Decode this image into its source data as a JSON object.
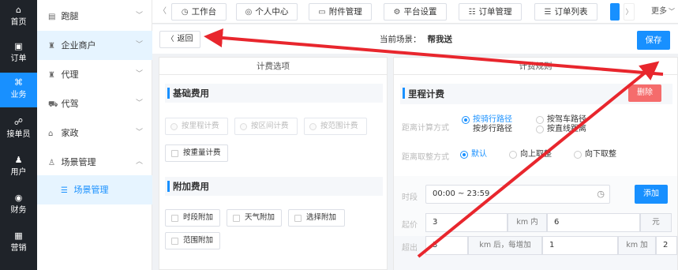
{
  "rail": [
    {
      "icon": "⌂",
      "label": "首页"
    },
    {
      "icon": "▣",
      "label": "订单"
    },
    {
      "icon": "⌘",
      "label": "业务"
    },
    {
      "icon": "☍",
      "label": "接单员"
    },
    {
      "icon": "♟",
      "label": "用户"
    },
    {
      "icon": "◉",
      "label": "财务"
    },
    {
      "icon": "▦",
      "label": "营销"
    }
  ],
  "sidebar": {
    "items": [
      {
        "icon": "▤",
        "label": "跑腿"
      },
      {
        "icon": "♜",
        "label": "企业商户"
      },
      {
        "icon": "♜",
        "label": "代理"
      },
      {
        "icon": "⛟",
        "label": "代驾"
      },
      {
        "icon": "⌂",
        "label": "家政"
      },
      {
        "icon": "♙",
        "label": "场景管理"
      },
      {
        "icon": "☰",
        "label": "场景管理"
      }
    ]
  },
  "tabs": [
    {
      "icon": "◷",
      "label": "工作台"
    },
    {
      "icon": "◎",
      "label": "个人中心"
    },
    {
      "icon": "▭",
      "label": "附件管理"
    },
    {
      "icon": "⚙",
      "label": "平台设置"
    },
    {
      "icon": "☷",
      "label": "订单管理"
    },
    {
      "icon": "☰",
      "label": "订单列表"
    }
  ],
  "more_label": "更多",
  "header": {
    "back_label": "返回",
    "scene_label": "当前场景：",
    "scene_name": "帮我送",
    "save_label": "保存"
  },
  "left_panel": {
    "title": "计费选项",
    "basic_title": "基础费用",
    "basic_options": [
      "按里程计费",
      "按区间计费",
      "按范围计费"
    ],
    "weight_option": "按重量计费",
    "extra_title": "附加费用",
    "extra_options": [
      "时段附加",
      "天气附加",
      "选择附加",
      "范围附加"
    ]
  },
  "right_panel": {
    "title": "计费规则",
    "section_title": "里程计费",
    "delete_label": "删除",
    "distance_calc_label": "距离计算方式",
    "distance_calc_options": [
      "按骑行路径",
      "按驾车路径",
      "按步行路径",
      "按直线距离"
    ],
    "round_label": "距离取整方式",
    "round_options": [
      "默认",
      "向上取整",
      "向下取整"
    ],
    "period_label": "时段",
    "period_value": "00:00 ~ 23:59",
    "add_label": "添加",
    "start_price_label": "起价",
    "start_km": "3",
    "start_km_unit": "km 内",
    "start_price": "6",
    "start_price_unit": "元",
    "over_label": "超出",
    "over_km": "3",
    "over_unit": "km 后，每增加",
    "over_step": "1",
    "over_step_unit": "km 加",
    "over_price": "2"
  },
  "colors": {
    "accent": "#1890ff",
    "rail": "#1f2329",
    "danger": "#f56c6c",
    "annotation": "#e8262d"
  }
}
